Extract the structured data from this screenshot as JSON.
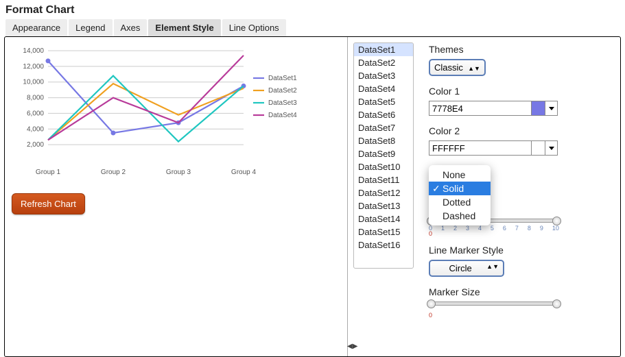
{
  "header": {
    "title": "Format Chart"
  },
  "tabs": [
    {
      "id": "appearance",
      "label": "Appearance",
      "active": false
    },
    {
      "id": "legend",
      "label": "Legend",
      "active": false
    },
    {
      "id": "axes",
      "label": "Axes",
      "active": false
    },
    {
      "id": "element-style",
      "label": "Element Style",
      "active": true
    },
    {
      "id": "line-options",
      "label": "Line Options",
      "active": false
    }
  ],
  "buttons": {
    "refresh": "Refresh Chart"
  },
  "chart_data": {
    "type": "line",
    "categories": [
      "Group 1",
      "Group 2",
      "Group 3",
      "Group 4"
    ],
    "ylim": [
      0,
      14000
    ],
    "yticks": [
      2000,
      4000,
      6000,
      8000,
      10000,
      12000,
      14000
    ],
    "series": [
      {
        "name": "DataSet1",
        "color": "#7778E4",
        "values": [
          12700,
          3500,
          4800,
          9500
        ],
        "marker": "circle"
      },
      {
        "name": "DataSet2",
        "color": "#f0a020",
        "values": [
          2600,
          9800,
          5800,
          9200
        ],
        "marker": "none"
      },
      {
        "name": "DataSet3",
        "color": "#1fc6c0",
        "values": [
          2600,
          10800,
          2400,
          9500
        ],
        "marker": "none"
      },
      {
        "name": "DataSet4",
        "color": "#b83b9a",
        "values": [
          2600,
          8000,
          4800,
          13400
        ],
        "marker": "none"
      }
    ]
  },
  "dataset_list": {
    "selected": "DataSet1",
    "items": [
      "DataSet1",
      "DataSet2",
      "DataSet3",
      "DataSet4",
      "DataSet5",
      "DataSet6",
      "DataSet7",
      "DataSet8",
      "DataSet9",
      "DataSet10",
      "DataSet11",
      "DataSet12",
      "DataSet13",
      "DataSet14",
      "DataSet15",
      "DataSet16"
    ]
  },
  "controls": {
    "themes": {
      "label": "Themes",
      "value": "Classic"
    },
    "color1": {
      "label": "Color 1",
      "value": "7778E4",
      "swatch": "#7778E4"
    },
    "color2": {
      "label": "Color 2",
      "value": "FFFFFF",
      "swatch": "#FFFFFF"
    },
    "line_style": {
      "options": [
        "None",
        "Solid",
        "Dotted",
        "Dashed"
      ],
      "selected": "Solid"
    },
    "line_width_slider": {
      "min": 0,
      "max": 10,
      "value": 0,
      "ticks": [
        0,
        1,
        2,
        3,
        4,
        5,
        6,
        7,
        8,
        9,
        10
      ]
    },
    "marker_style": {
      "label": "Line Marker Style",
      "value": "Circle"
    },
    "marker_size": {
      "label": "Marker Size",
      "min": 0,
      "value": 0
    }
  }
}
